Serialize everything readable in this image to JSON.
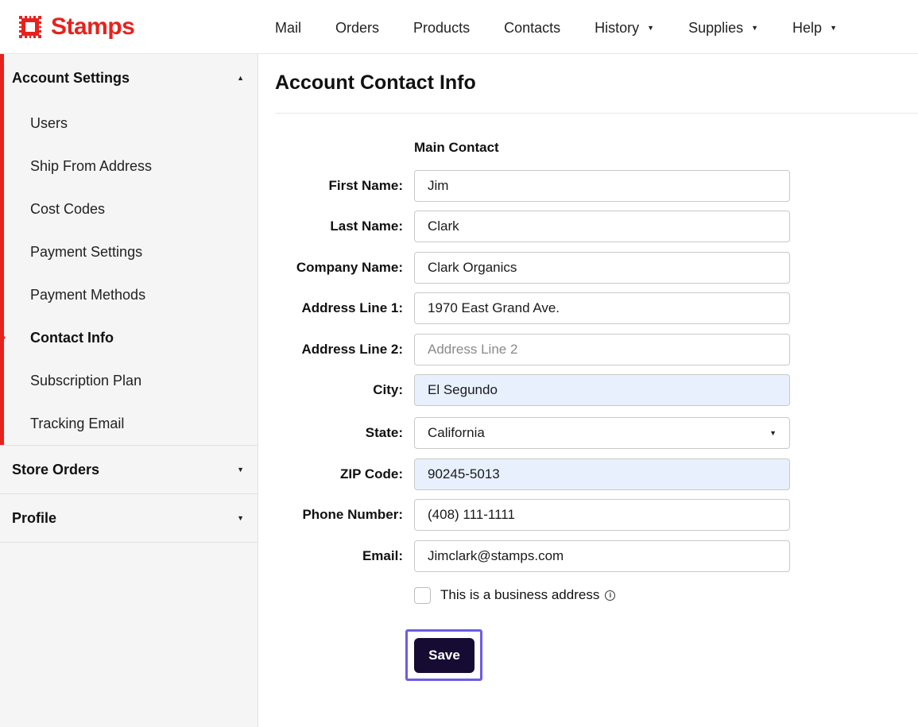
{
  "brand": {
    "name": "Stamps",
    "color": "#e8211d"
  },
  "nav": {
    "items": [
      {
        "label": "Mail",
        "dropdown": false
      },
      {
        "label": "Orders",
        "dropdown": false
      },
      {
        "label": "Products",
        "dropdown": false
      },
      {
        "label": "Contacts",
        "dropdown": false
      },
      {
        "label": "History",
        "dropdown": true
      },
      {
        "label": "Supplies",
        "dropdown": true
      },
      {
        "label": "Help",
        "dropdown": true
      }
    ]
  },
  "sidebar": {
    "account_settings": {
      "label": "Account Settings",
      "expanded": true,
      "items": [
        {
          "label": "Users"
        },
        {
          "label": "Ship From Address"
        },
        {
          "label": "Cost Codes"
        },
        {
          "label": "Payment Settings"
        },
        {
          "label": "Payment Methods"
        },
        {
          "label": "Contact Info",
          "active": true
        },
        {
          "label": "Subscription Plan"
        },
        {
          "label": "Tracking Email"
        }
      ]
    },
    "store_orders": {
      "label": "Store Orders"
    },
    "profile": {
      "label": "Profile"
    }
  },
  "main": {
    "title": "Account Contact Info",
    "section": "Main Contact",
    "fields": {
      "first_name": {
        "label": "First Name:",
        "value": "Jim"
      },
      "last_name": {
        "label": "Last Name:",
        "value": "Clark"
      },
      "company": {
        "label": "Company Name:",
        "value": "Clark Organics"
      },
      "address1": {
        "label": "Address Line 1:",
        "value": "1970 East Grand Ave."
      },
      "address2": {
        "label": "Address Line 2:",
        "value": "",
        "placeholder": "Address Line 2"
      },
      "city": {
        "label": "City:",
        "value": "El Segundo"
      },
      "state": {
        "label": "State:",
        "value": "California"
      },
      "zip": {
        "label": "ZIP Code:",
        "value": "90245-5013"
      },
      "phone": {
        "label": "Phone Number:",
        "value": "(408) 111-1111"
      },
      "email": {
        "label": "Email:",
        "value": "Jimclark@stamps.com"
      }
    },
    "business_checkbox": {
      "label": "This is a business address",
      "checked": false
    },
    "save_label": "Save"
  },
  "colors": {
    "accent": "#e8211d",
    "button": "#160b33",
    "focus_ring": "#6b5ce7",
    "autofill": "#e8f0fe"
  }
}
